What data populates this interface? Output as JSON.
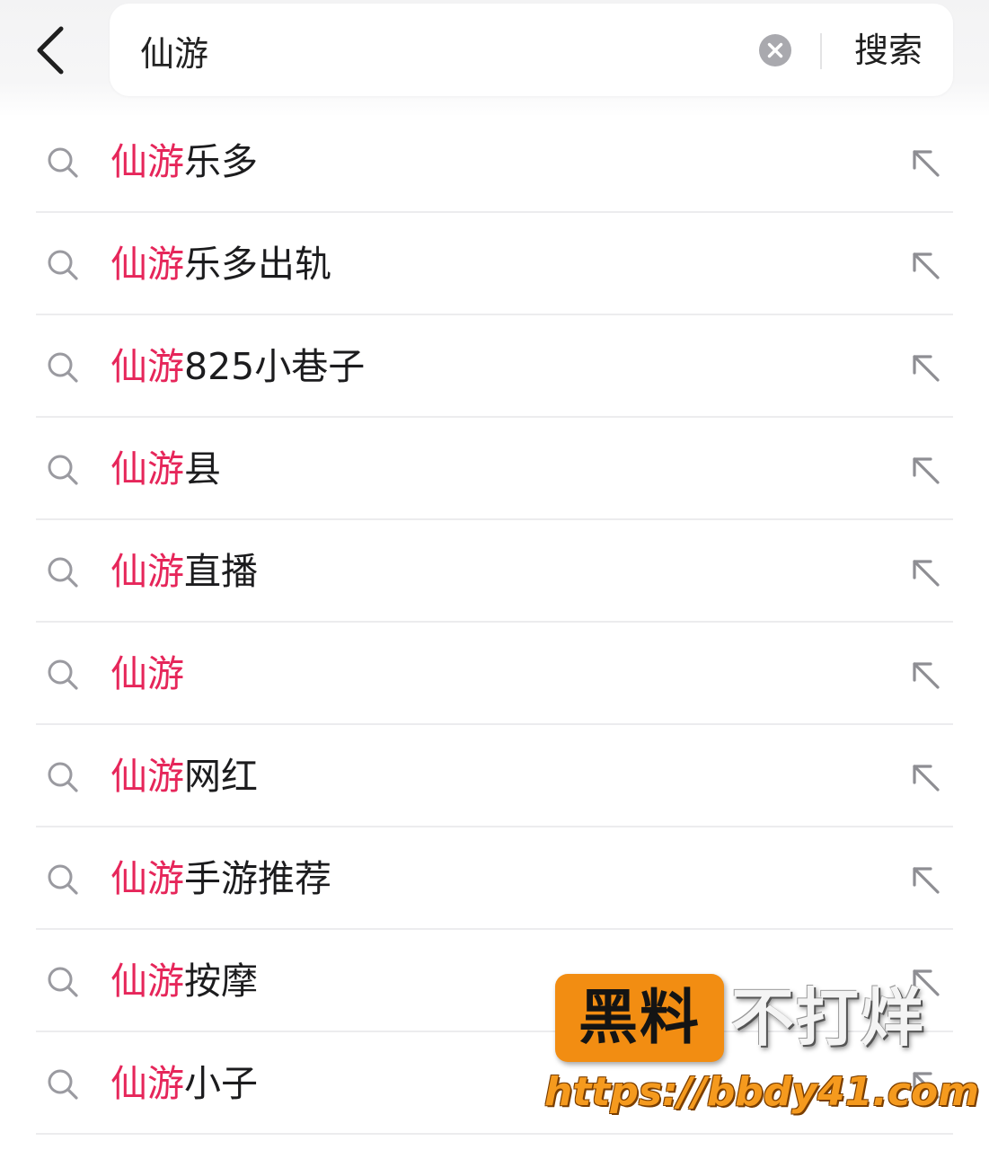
{
  "search": {
    "value": "仙游",
    "submit_label": "搜索"
  },
  "icons": {
    "back": "chevron-left-icon",
    "clear": "clear-circle-icon",
    "suggestion": "search-icon",
    "fill": "arrow-up-left-icon"
  },
  "colors": {
    "highlight": "#e6265a",
    "text": "#1c1c1e",
    "watermark_badge": "#f28d12"
  },
  "suggestions": [
    {
      "highlight": "仙游",
      "rest": "乐多"
    },
    {
      "highlight": "仙游",
      "rest": "乐多出轨"
    },
    {
      "highlight": "仙游",
      "rest": "825小巷子"
    },
    {
      "highlight": "仙游",
      "rest": "县"
    },
    {
      "highlight": "仙游",
      "rest": "直播"
    },
    {
      "highlight": "仙游",
      "rest": ""
    },
    {
      "highlight": "仙游",
      "rest": "网红"
    },
    {
      "highlight": "仙游",
      "rest": "手游推荐"
    },
    {
      "highlight": "仙游",
      "rest": "按摩"
    },
    {
      "highlight": "仙游",
      "rest": "小子"
    }
  ],
  "watermark": {
    "badge": "黑料",
    "text": "不打烊",
    "url": "https://bbdy41.com"
  }
}
